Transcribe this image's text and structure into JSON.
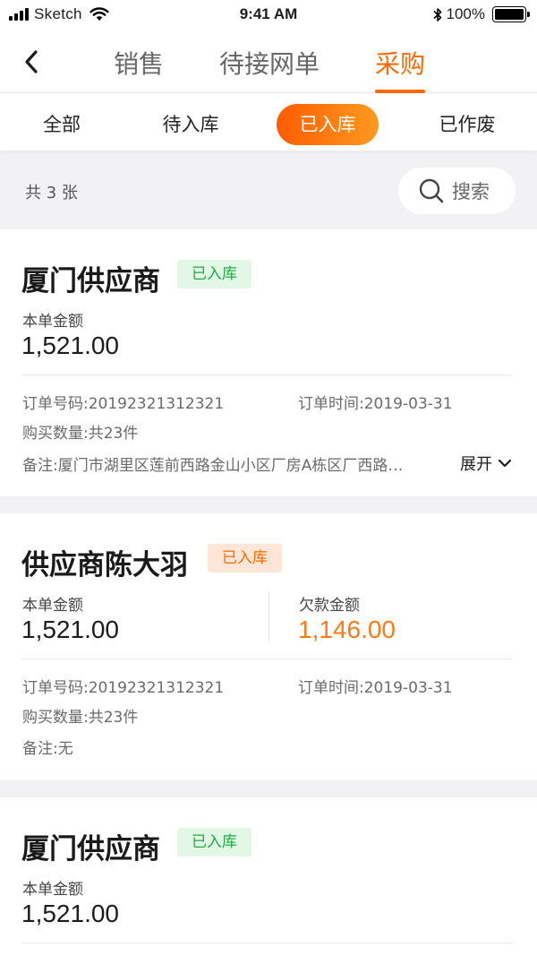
{
  "status_bar": {
    "carrier": "Sketch",
    "time": "9:41 AM",
    "battery": "100%"
  },
  "nav": {
    "tabs": [
      {
        "label": "销售",
        "active": false
      },
      {
        "label": "待接网单",
        "active": false
      },
      {
        "label": "采购",
        "active": true
      }
    ]
  },
  "filters": [
    {
      "label": "全部",
      "active": false
    },
    {
      "label": "待入库",
      "active": false
    },
    {
      "label": "已入库",
      "active": true
    },
    {
      "label": "已作废",
      "active": false
    }
  ],
  "summary": {
    "count_text": "共 3 张",
    "search_label": "搜索"
  },
  "orders": [
    {
      "supplier": "厦门供应商",
      "status": "已入库",
      "status_color": "#1eab3f",
      "amount_label": "本单金额",
      "amount": "1,521.00",
      "order_no": "订单号码:20192321312321",
      "order_time": "订单时间:2019-03-31",
      "quantity": "购买数量:共23件",
      "note": "备注:厦门市湖里区莲前西路金山小区厂房A栋区厂西路…",
      "expand_label": "展开"
    },
    {
      "supplier": "供应商陈大羽",
      "status": "已入库",
      "status_color": "#ff6a00",
      "amount_label": "本单金额",
      "amount": "1,521.00",
      "debt_label": "欠款金额",
      "debt": "1,146.00",
      "order_no": "订单号码:20192321312321",
      "order_time": "订单时间:2019-03-31",
      "quantity": "购买数量:共23件",
      "note": "备注:无"
    },
    {
      "supplier": "厦门供应商",
      "status": "已入库",
      "status_color": "#1eab3f",
      "amount_label": "本单金额",
      "amount": "1,521.00"
    }
  ],
  "colors": {
    "accent": "#ff6a00",
    "success": "#1eab3f"
  },
  "icons": {
    "back": "chevron-left-icon",
    "search": "search-icon",
    "expand": "chevron-down-icon"
  }
}
